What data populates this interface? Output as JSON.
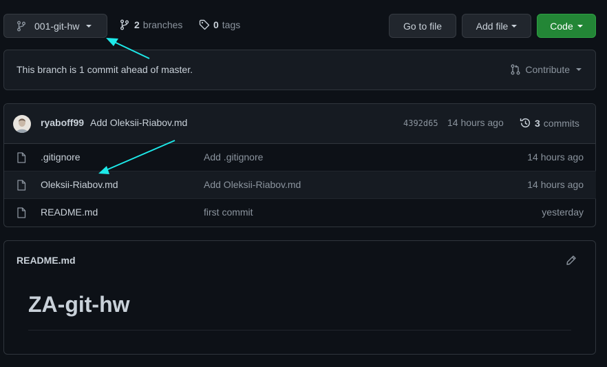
{
  "branch_selector": {
    "label": "001-git-hw",
    "icon": "git-branch-icon"
  },
  "branches": {
    "count": "2",
    "label": "branches"
  },
  "tags": {
    "count": "0",
    "label": "tags"
  },
  "buttons": {
    "go_to_file": "Go to file",
    "add_file": "Add file",
    "code": "Code"
  },
  "ahead_banner": {
    "text": "This branch is 1 commit ahead of master.",
    "contribute": "Contribute"
  },
  "latest_commit": {
    "author": "ryaboff99",
    "message": "Add Oleksii-Riabov.md",
    "sha": "4392d65",
    "time": "14 hours ago",
    "commits_count": "3",
    "commits_label": "commits"
  },
  "files": [
    {
      "name": ".gitignore",
      "message": "Add .gitignore",
      "age": "14 hours ago"
    },
    {
      "name": "Oleksii-Riabov.md",
      "message": "Add Oleksii-Riabov.md",
      "age": "14 hours ago"
    },
    {
      "name": "README.md",
      "message": "first commit",
      "age": "yesterday"
    }
  ],
  "readme": {
    "filename": "README.md",
    "heading": "ZA-git-hw"
  },
  "colors": {
    "background": "#0d1117",
    "border": "#30363d",
    "code_button": "#238636",
    "annotation_arrow": "#1de9e9"
  }
}
